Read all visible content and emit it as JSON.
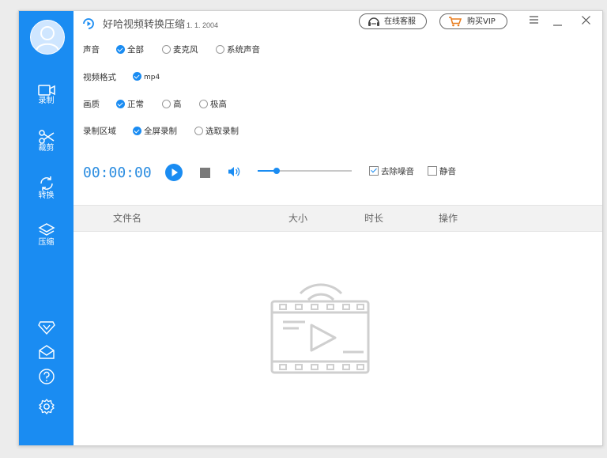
{
  "app": {
    "title": "好哈视频转换压缩",
    "version": "1. 1. 2004",
    "service_label": "在线客服",
    "vip_label": "购买VIP"
  },
  "sidebar": {
    "items": [
      {
        "label": "录制",
        "icon": "camera-icon",
        "active": true
      },
      {
        "label": "裁剪",
        "icon": "scissors-icon"
      },
      {
        "label": "转换",
        "icon": "refresh-icon"
      },
      {
        "label": "压缩",
        "icon": "layers-icon"
      }
    ],
    "bottom_icons": [
      "vip-icon",
      "mail-icon",
      "help-icon",
      "gear-icon"
    ]
  },
  "settings": {
    "audio": {
      "label": "声音",
      "options": [
        "全部",
        "麦克风",
        "系统声音"
      ],
      "selected": "全部"
    },
    "format": {
      "label": "视频格式",
      "options": [
        "mp4"
      ],
      "selected": "mp4"
    },
    "quality": {
      "label": "画质",
      "options": [
        "正常",
        "高",
        "极高"
      ],
      "selected": "正常"
    },
    "area": {
      "label": "录制区域",
      "options": [
        "全屏录制",
        "选取录制"
      ],
      "selected": "全屏录制"
    }
  },
  "recorder": {
    "timer": "00:00:00",
    "volume_fraction": 0.2,
    "denoise": {
      "label": "去除噪音",
      "checked": true
    },
    "mute": {
      "label": "静音",
      "checked": false
    }
  },
  "table": {
    "columns": [
      "文件名",
      "大小",
      "时长",
      "操作"
    ],
    "rows": []
  },
  "colors": {
    "accent": "#1a8cf2",
    "timer": "#2a8ce0"
  }
}
